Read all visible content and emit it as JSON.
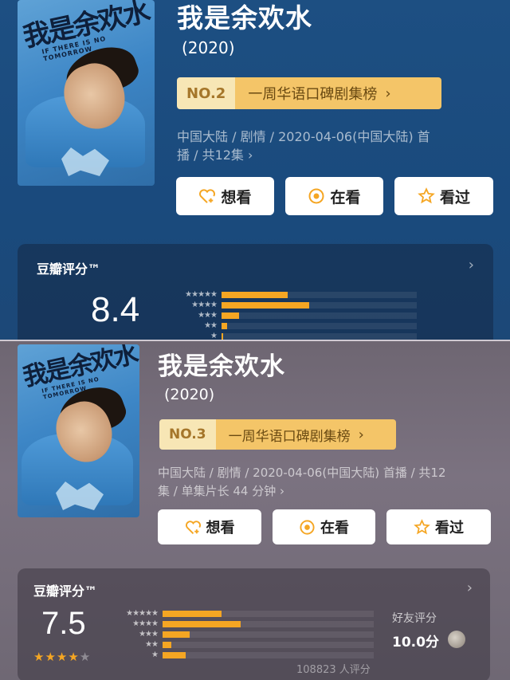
{
  "top": {
    "poster": {
      "title_art": "我是余欢水",
      "subtitle_art": "IF THERE IS NO TOMORROW"
    },
    "title": "我是余欢水",
    "year": "(2020)",
    "rank": {
      "no": "NO.2",
      "list": "一周华语口碑剧集榜",
      "arrow": "›"
    },
    "meta_line1": "中国大陆 / 剧情 / 2020-04-06(中国大陆) 首",
    "meta_line2": "播 / 共12集 ›",
    "buttons": {
      "want": "想看",
      "watching": "在看",
      "watched": "看过"
    },
    "rating": {
      "label": "豆瓣评分™",
      "chevron": "›",
      "score": "8.4",
      "distribution": [
        0.34,
        0.45,
        0.09,
        0.03,
        0.01
      ]
    }
  },
  "bottom": {
    "poster": {
      "title_art": "我是余欢水",
      "subtitle_art": "IF THERE IS NO TOMORROW"
    },
    "title": "我是余欢水",
    "year": "(2020)",
    "rank": {
      "no": "NO.3",
      "list": "一周华语口碑剧集榜",
      "arrow": "›"
    },
    "meta_line1": "中国大陆 / 剧情 / 2020-04-06(中国大陆) 首播 / 共12",
    "meta_line2": "集 / 单集片长 44 分钟 ›",
    "buttons": {
      "want": "想看",
      "watching": "在看",
      "watched": "看过"
    },
    "rating": {
      "label": "豆瓣评分™",
      "chevron": "›",
      "score": "7.5",
      "stars_filled": 4,
      "stars_total": 5,
      "distribution": [
        0.28,
        0.37,
        0.13,
        0.04,
        0.11
      ],
      "friend_label": "好友评分",
      "friend_score": "10.0分",
      "count": "108823 人评分"
    }
  },
  "colors": {
    "accent": "#f5a623",
    "rank_no_bg": "#f7e6b5",
    "rank_list_bg": "#f4c568"
  },
  "icons": [
    "heart-plus-icon",
    "eye-circle-icon",
    "star-outline-icon"
  ],
  "star_glyphs": [
    "★★★★★",
    "★★★★",
    "★★★",
    "★★",
    "★"
  ]
}
